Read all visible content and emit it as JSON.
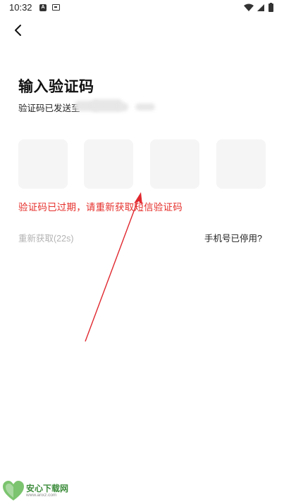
{
  "status_bar": {
    "time": "10:32",
    "left_icons": [
      "a-badge-icon",
      "screen-icon"
    ],
    "right_icons": [
      "wifi-icon",
      "signal-icon",
      "battery-icon"
    ]
  },
  "header": {
    "back_icon": "chevron-left-icon"
  },
  "verification": {
    "title": "输入验证码",
    "sent_to": "验证码已发送至",
    "code_boxes": [
      "",
      "",
      "",
      ""
    ],
    "error": "验证码已过期，请重新获取短信验证码",
    "resend": "重新获取(22s)",
    "phone_disabled": "手机号已停用?"
  },
  "watermark": {
    "title": "安心下载网",
    "url": "www.anxz.com"
  },
  "colors": {
    "error_red": "#e5302c",
    "box_bg": "#f5f5f5",
    "muted_text": "#b3b3b3",
    "watermark_green": "#3d8c3c",
    "annotation_red": "#e0272e"
  }
}
